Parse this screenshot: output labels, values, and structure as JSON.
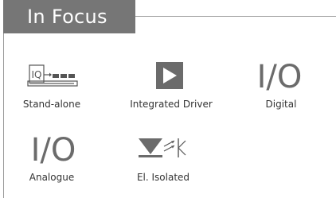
{
  "panel": {
    "title": "In Focus",
    "accent_color": "#767676",
    "line_color": "#9a9a9a"
  },
  "tiles": [
    {
      "label": "Stand-alone",
      "icon": "standalone-iq-icon",
      "icon_text": "IQ"
    },
    {
      "label": "Integrated Driver",
      "icon": "play-icon"
    },
    {
      "label": "Digital",
      "icon": "io-icon",
      "icon_text": "I/O"
    },
    {
      "label": "Analogue",
      "icon": "io-icon",
      "icon_text": "I/O"
    },
    {
      "label": "El. Isolated",
      "icon": "optocoupler-icon"
    }
  ]
}
